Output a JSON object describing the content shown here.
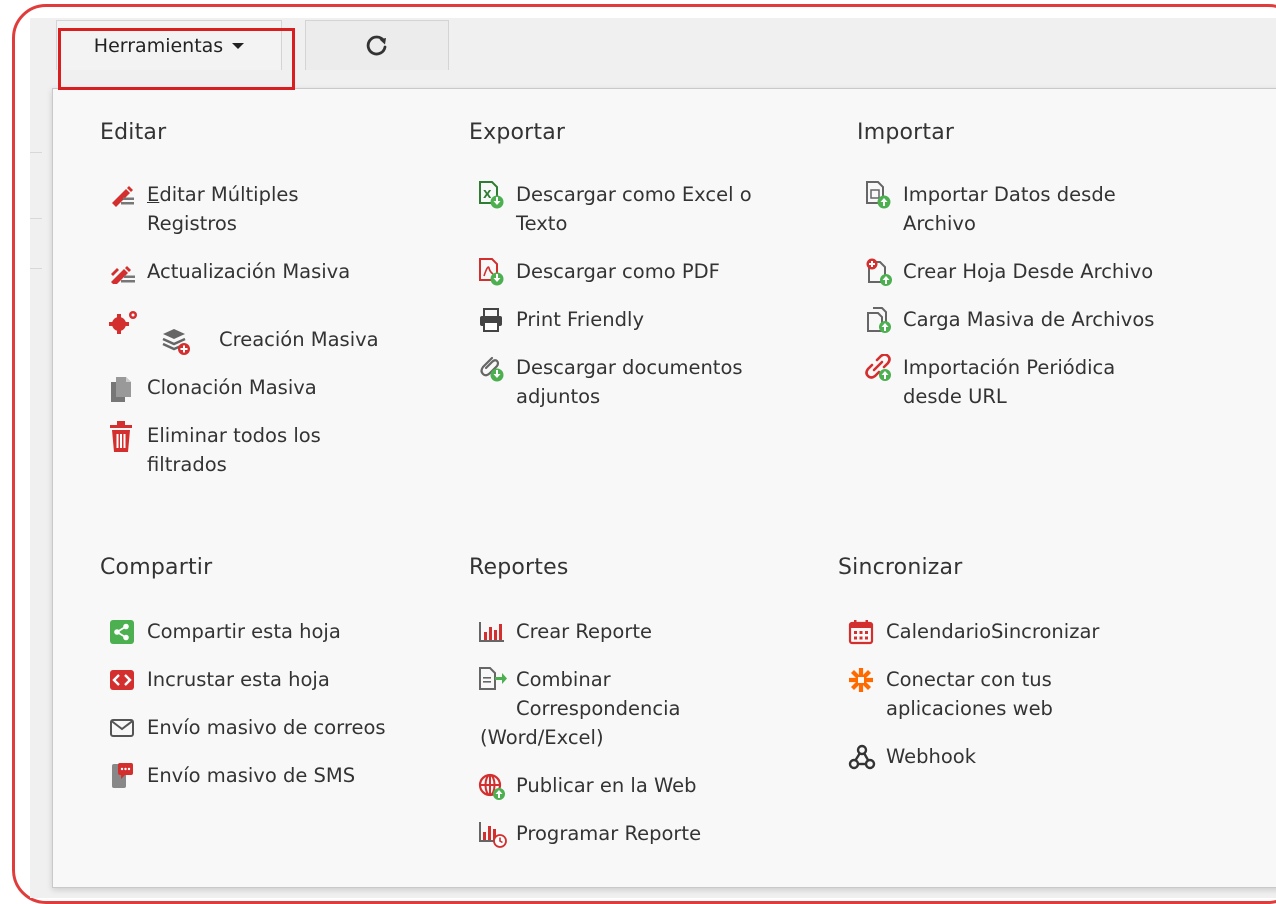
{
  "toolbar": {
    "herramientas_label": "Herramientas"
  },
  "sections": {
    "editar": {
      "title": "Editar",
      "items": [
        {
          "label_underlined": "E",
          "label_rest": "ditar Múltiples\nRegistros"
        },
        {
          "label": "Actualización Masiva"
        },
        {
          "label": "Creación Masiva"
        },
        {
          "label": "Clonación Masiva"
        },
        {
          "label": "Eliminar todos los\nfiltrados"
        }
      ]
    },
    "exportar": {
      "title": "Exportar",
      "items": [
        {
          "label": "Descargar como Excel o\nTexto"
        },
        {
          "label": "Descargar como PDF"
        },
        {
          "label": "Print Friendly"
        },
        {
          "label": "Descargar documentos\nadjuntos"
        }
      ]
    },
    "importar": {
      "title": "Importar",
      "items": [
        {
          "label": "Importar Datos desde\nArchivo"
        },
        {
          "label": "Crear Hoja Desde Archivo"
        },
        {
          "label": "Carga Masiva de Archivos"
        },
        {
          "label": "Importación Periódica\ndesde URL"
        }
      ]
    },
    "compartir": {
      "title": "Compartir",
      "items": [
        {
          "label": "Compartir esta hoja"
        },
        {
          "label": "Incrustar esta hoja"
        },
        {
          "label": "Envío masivo de correos"
        },
        {
          "label": "Envío masivo de SMS"
        }
      ]
    },
    "reportes": {
      "title": "Reportes",
      "items": [
        {
          "label": "Crear Reporte"
        },
        {
          "label": "Combinar"
        },
        {
          "label": "Correspondencia"
        },
        {
          "label": "(Word/Excel)"
        },
        {
          "label": "Publicar en la Web"
        },
        {
          "label": "Programar Reporte"
        }
      ]
    },
    "sincronizar": {
      "title": "Sincronizar",
      "items": [
        {
          "label": "CalendarioSincronizar"
        },
        {
          "label": "Conectar con tus\naplicaciones web"
        },
        {
          "label": "Webhook"
        }
      ]
    }
  },
  "colors": {
    "highlight_border": "#d81e1e",
    "frame_border": "#e03c3c",
    "icon_red": "#d32f2f",
    "icon_green": "#4caf50",
    "icon_gray": "#555555",
    "icon_orange": "#ff6a00"
  }
}
